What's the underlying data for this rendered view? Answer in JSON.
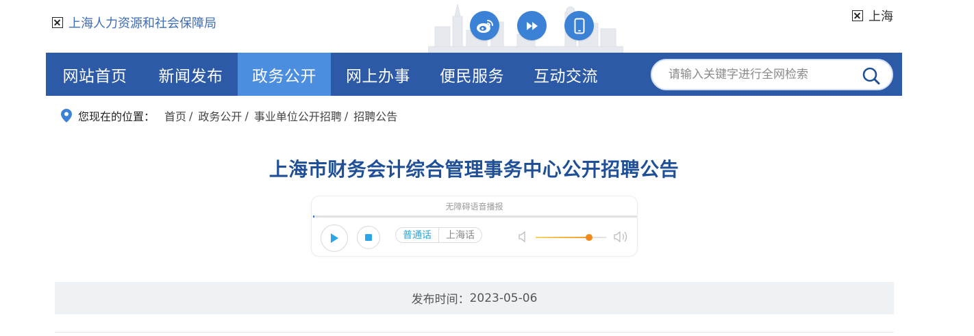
{
  "header": {
    "site_title": "上海人力资源和社会保障局",
    "region": "上海"
  },
  "social": [
    {
      "icon": "weibo-icon",
      "name": "weibo-button"
    },
    {
      "icon": "fast-forward-icon",
      "name": "feed-button"
    },
    {
      "icon": "mobile-icon",
      "name": "mobile-button"
    }
  ],
  "nav": {
    "items": [
      {
        "label": "网站首页",
        "active": false
      },
      {
        "label": "新闻发布",
        "active": false
      },
      {
        "label": "政务公开",
        "active": true
      },
      {
        "label": "网上办事",
        "active": false
      },
      {
        "label": "便民服务",
        "active": false
      },
      {
        "label": "互动交流",
        "active": false
      }
    ]
  },
  "search": {
    "placeholder": "请输入关键字进行全网检索",
    "value": ""
  },
  "breadcrumb": {
    "label": "您现在的位置：",
    "items": [
      "首页",
      "政务公开",
      "事业单位公开招聘",
      "招聘公告"
    ],
    "separator": "/"
  },
  "article": {
    "title": "上海市财务会计综合管理事务中心公开招聘公告",
    "publish_label": "发布时间：",
    "publish_date": "2023-05-06"
  },
  "player": {
    "label": "无障碍语音播报",
    "progress": 0,
    "dialects": [
      "普通话",
      "上海话"
    ],
    "selected_dialect": "普通话",
    "volume": 0.76
  },
  "colors": {
    "nav_bg": "#2c5aa7",
    "nav_active": "#4b8ee0",
    "title": "#1f4f96",
    "social": "#3b82d6"
  }
}
